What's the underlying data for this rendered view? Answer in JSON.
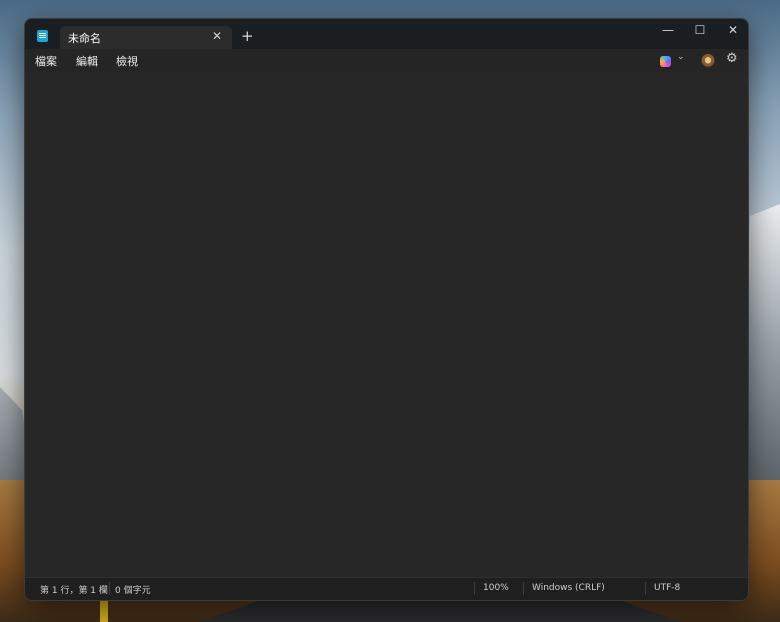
{
  "tab": {
    "title": "未命名"
  },
  "menu": [
    "檔案",
    "編輯",
    "檢視"
  ],
  "editor": {
    "content": ""
  },
  "status": {
    "position": "第 1 行，第 1 欄",
    "chars": "0 個字元",
    "zoom": "100%",
    "line_ending": "Windows (CRLF)",
    "encoding": "UTF-8"
  },
  "icons": {
    "app": "notepad-icon",
    "tab_close": "close-icon",
    "new_tab": "plus-icon",
    "minimize": "minimize-icon",
    "maximize": "maximize-icon",
    "close": "close-icon",
    "copilot": "copilot-icon",
    "chevron": "chevron-down-icon",
    "account": "avatar-icon",
    "settings": "gear-icon"
  },
  "colors": {
    "accent": "#19a7d8",
    "background": "#272727",
    "titlebar": "#1a1e20"
  }
}
